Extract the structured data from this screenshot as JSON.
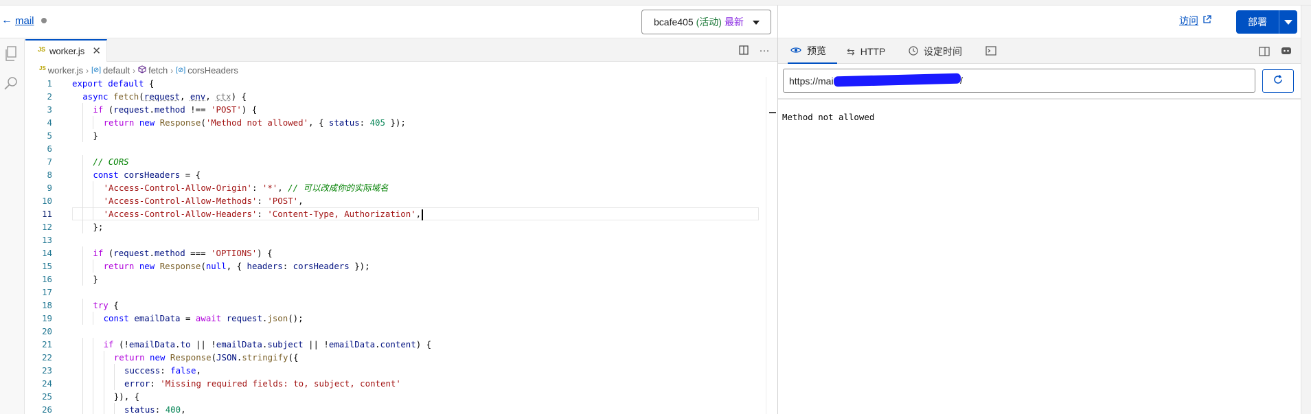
{
  "header": {
    "back_label": "mail",
    "version": {
      "id": "bcafe405",
      "status": "(活动)",
      "latest": "最新"
    }
  },
  "right_header": {
    "visit_label": "访问",
    "deploy_label": "部署"
  },
  "editor": {
    "tab_label": "worker.js",
    "breadcrumb": [
      "worker.js",
      "default",
      "fetch",
      "corsHeaders"
    ],
    "active_line": 11,
    "lines": [
      {
        "n": "1",
        "indent": 0,
        "html": "<span class='tk-kw'>export</span> <span class='tk-kw'>default</span> <span class='tk-plain'>{</span>"
      },
      {
        "n": "2",
        "indent": 1,
        "html": "<span class='tk-kw'>async</span> <span class='tk-fn'>fetch</span><span class='tk-plain'>(</span><span class='tk-var tk-dot'>request</span><span class='tk-plain'>, </span><span class='tk-var tk-dot'>env</span><span class='tk-plain'>, </span><span class='tk-dim tk-dot'>ctx</span><span class='tk-plain'>) {</span>"
      },
      {
        "n": "3",
        "indent": 2,
        "html": "<span class='tk-ctl'>if</span> <span class='tk-plain'>(</span><span class='tk-var'>request</span><span class='tk-plain'>.</span><span class='tk-var'>method</span> <span class='tk-plain'>!==</span> <span class='tk-str'>'POST'</span><span class='tk-plain'>) {</span>"
      },
      {
        "n": "4",
        "indent": 3,
        "html": "<span class='tk-ctl'>return</span> <span class='tk-kw'>new</span> <span class='tk-fn'>Response</span><span class='tk-plain'>(</span><span class='tk-str'>'Method not allowed'</span><span class='tk-plain'>, { </span><span class='tk-var'>status</span><span class='tk-plain'>: </span><span class='tk-num'>405</span> <span class='tk-plain'>});</span>"
      },
      {
        "n": "5",
        "indent": 2,
        "html": "<span class='tk-plain'>}</span>"
      },
      {
        "n": "6",
        "indent": 0,
        "html": ""
      },
      {
        "n": "7",
        "indent": 2,
        "html": "<span class='tk-com'>// CORS</span>"
      },
      {
        "n": "8",
        "indent": 2,
        "html": "<span class='tk-kw'>const</span> <span class='tk-var'>corsHeaders</span> <span class='tk-plain'>= {</span>"
      },
      {
        "n": "9",
        "indent": 3,
        "html": "<span class='tk-str'>'Access-Control-Allow-Origin'</span><span class='tk-plain'>: </span><span class='tk-str'>'*'</span><span class='tk-plain'>, </span><span class='tk-com'>// 可以改成你的实际域名</span>"
      },
      {
        "n": "10",
        "indent": 3,
        "html": "<span class='tk-str'>'Access-Control-Allow-Methods'</span><span class='tk-plain'>: </span><span class='tk-str'>'POST'</span><span class='tk-plain'>,</span>"
      },
      {
        "n": "11",
        "indent": 3,
        "html": "<span class='tk-str'>'Access-Control-Allow-Headers'</span><span class='tk-plain'>: </span><span class='tk-str'>'Content-Type, Authorization'</span><span class='tk-plain'>,</span><span class='cursor'></span>"
      },
      {
        "n": "12",
        "indent": 2,
        "html": "<span class='tk-plain'>};</span>"
      },
      {
        "n": "13",
        "indent": 0,
        "html": ""
      },
      {
        "n": "14",
        "indent": 2,
        "html": "<span class='tk-ctl'>if</span> <span class='tk-plain'>(</span><span class='tk-var'>request</span><span class='tk-plain'>.</span><span class='tk-var'>method</span> <span class='tk-plain'>===</span> <span class='tk-str'>'OPTIONS'</span><span class='tk-plain'>) {</span>"
      },
      {
        "n": "15",
        "indent": 3,
        "html": "<span class='tk-ctl'>return</span> <span class='tk-kw'>new</span> <span class='tk-fn'>Response</span><span class='tk-plain'>(</span><span class='tk-kw'>null</span><span class='tk-plain'>, { </span><span class='tk-var'>headers</span><span class='tk-plain'>: </span><span class='tk-var'>corsHeaders</span> <span class='tk-plain'>});</span>"
      },
      {
        "n": "16",
        "indent": 2,
        "html": "<span class='tk-plain'>}</span>"
      },
      {
        "n": "17",
        "indent": 0,
        "html": ""
      },
      {
        "n": "18",
        "indent": 2,
        "html": "<span class='tk-ctl'>try</span> <span class='tk-plain'>{</span>"
      },
      {
        "n": "19",
        "indent": 3,
        "html": "<span class='tk-kw'>const</span> <span class='tk-var'>emailData</span> <span class='tk-plain'>= </span><span class='tk-ctl'>await</span> <span class='tk-var'>request</span><span class='tk-plain'>.</span><span class='tk-fn'>json</span><span class='tk-plain'>();</span>"
      },
      {
        "n": "20",
        "indent": 0,
        "html": ""
      },
      {
        "n": "21",
        "indent": 3,
        "html": "<span class='tk-ctl'>if</span> <span class='tk-plain'>(!</span><span class='tk-var'>emailData</span><span class='tk-plain'>.</span><span class='tk-var'>to</span> <span class='tk-plain'>|| !</span><span class='tk-var'>emailData</span><span class='tk-plain'>.</span><span class='tk-var'>subject</span> <span class='tk-plain'>|| !</span><span class='tk-var'>emailData</span><span class='tk-plain'>.</span><span class='tk-var'>content</span><span class='tk-plain'>) {</span>"
      },
      {
        "n": "22",
        "indent": 4,
        "html": "<span class='tk-ctl'>return</span> <span class='tk-kw'>new</span> <span class='tk-fn'>Response</span><span class='tk-plain'>(</span><span class='tk-var'>JSON</span><span class='tk-plain'>.</span><span class='tk-fn'>stringify</span><span class='tk-plain'>({</span>"
      },
      {
        "n": "23",
        "indent": 5,
        "html": "<span class='tk-var'>success</span><span class='tk-plain'>: </span><span class='tk-kw'>false</span><span class='tk-plain'>,</span>"
      },
      {
        "n": "24",
        "indent": 5,
        "html": "<span class='tk-var'>error</span><span class='tk-plain'>: </span><span class='tk-str'>'Missing required fields: to, subject, content'</span>"
      },
      {
        "n": "25",
        "indent": 4,
        "html": "<span class='tk-plain'>}), {</span>"
      },
      {
        "n": "26",
        "indent": 5,
        "html": "<span class='tk-var'>status</span><span class='tk-plain'>: </span><span class='tk-num'>400</span><span class='tk-plain'>,</span>"
      }
    ]
  },
  "preview": {
    "tabs": [
      {
        "label": "预览",
        "icon": "eye-icon"
      },
      {
        "label": "HTTP",
        "icon": "arrows-icon"
      },
      {
        "label": "设定时间",
        "icon": "clock-icon"
      },
      {
        "label": "",
        "icon": "terminal-icon"
      }
    ],
    "url": "https://mai",
    "url_tail": "/",
    "output": "Method not allowed"
  }
}
